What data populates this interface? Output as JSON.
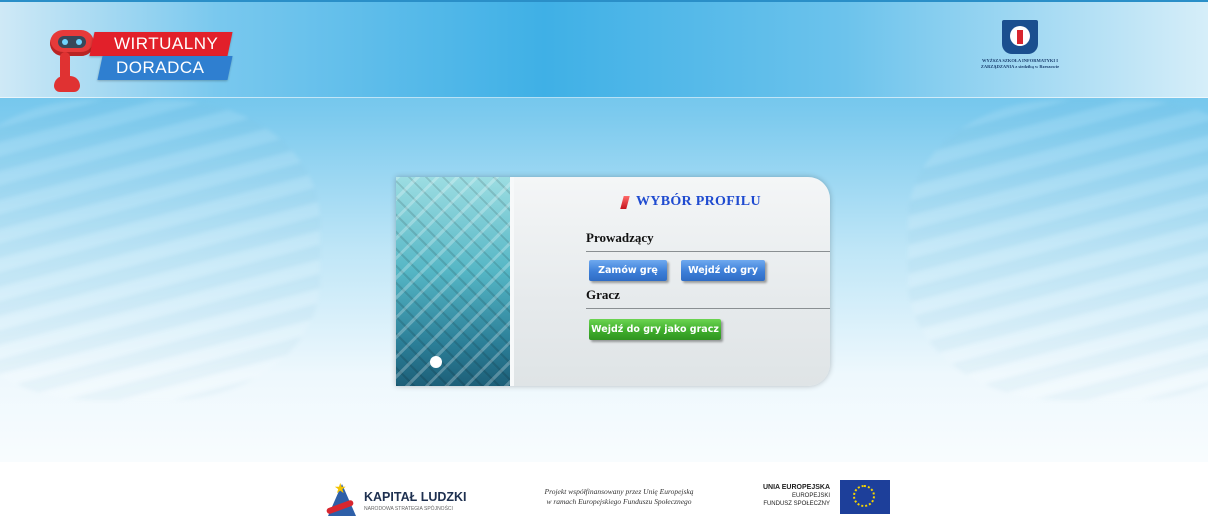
{
  "header": {
    "app_logo_line1": "WIRTUALNY",
    "app_logo_line2": "DORADCA",
    "school_logo_text": "WYŻSZA SZKOŁA INFORMATYKI I ZARZĄDZANIA z siedzibą w Rzeszowie"
  },
  "panel": {
    "title": "WYBÓR PROFILU",
    "sections": {
      "host": {
        "label": "Prowadzący",
        "order_button": "Zamów grę",
        "enter_button": "Wejdź do gry"
      },
      "player": {
        "label": "Gracz",
        "enter_as_player_button": "Wejdź do gry jako gracz"
      }
    }
  },
  "footer": {
    "kapital_title": "KAPITAŁ LUDZKI",
    "kapital_subtitle": "NARODOWA STRATEGIA SPÓJNOŚCI",
    "project_line1": "Projekt współfinansowany przez Unię Europejską",
    "project_line2": "w ramach Europejskiego Funduszu Społecznego",
    "eu_line1": "UNIA EUROPEJSKA",
    "eu_line2": "EUROPEJSKI",
    "eu_line3": "FUNDUSZ SPOŁECZNY"
  },
  "colors": {
    "title_blue": "#1f4bd0",
    "button_blue": "#3d7fd8",
    "button_green": "#3fae2c",
    "brand_red": "#e2202a"
  }
}
